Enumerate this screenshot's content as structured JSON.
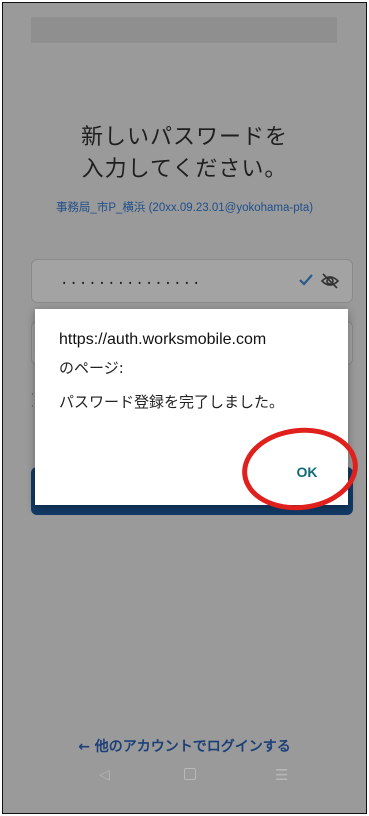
{
  "screen": {
    "title_line1": "新しいパスワードを",
    "title_line2": "入力してください。",
    "account": "事務局_市P_横浜 (20xx.09.23.01@yokohama-pta)",
    "password_masked": "...............",
    "login_other": "← 他のアカウントでログインする"
  },
  "dialog": {
    "url": "https://auth.worksmobile.com",
    "subtitle": "のページ:",
    "message": "パスワード登録を完了しました。",
    "ok_label": "OK"
  },
  "nav": {
    "back": "◁",
    "menu": "☰"
  },
  "colors": {
    "overlay": "#9a9a9a",
    "link": "#1f4f8a",
    "ok_teal": "#0f6c76",
    "highlight_red": "#e0201d",
    "button_navy": "#123a66"
  },
  "icons": [
    "check-icon",
    "eye-off-icon",
    "back-icon",
    "home-icon",
    "menu-icon"
  ]
}
